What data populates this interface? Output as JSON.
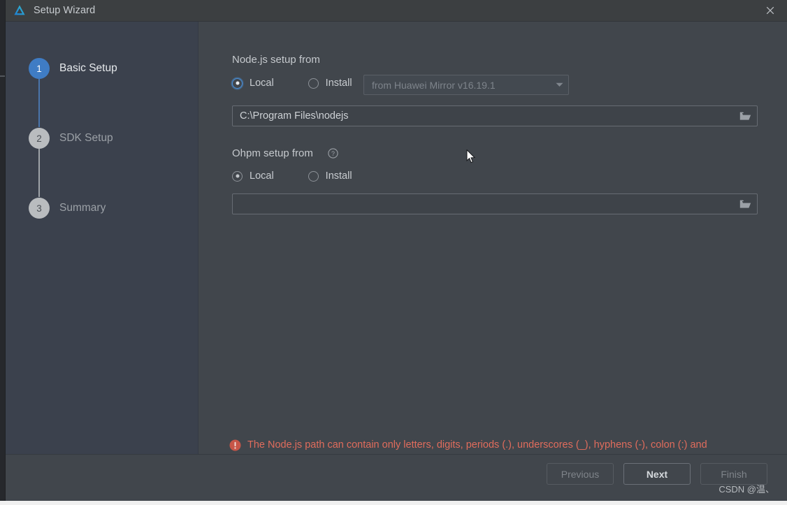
{
  "window": {
    "title": "Setup Wizard",
    "logo_icon": "deveco-logo-icon",
    "close_icon": "close-icon"
  },
  "stepper": {
    "steps": [
      {
        "number": "1",
        "label": "Basic Setup",
        "state": "active"
      },
      {
        "number": "2",
        "label": "SDK Setup",
        "state": "inactive"
      },
      {
        "number": "3",
        "label": "Summary",
        "state": "inactive"
      }
    ]
  },
  "nodejs": {
    "section_title": "Node.js setup from",
    "radios": [
      {
        "label": "Local",
        "selected": true
      },
      {
        "label": "Install",
        "selected": false
      }
    ],
    "mirror_combobox": {
      "value": "from Huawei Mirror v16.19.1",
      "enabled": false,
      "arrow_icon": "chevron-down-icon"
    },
    "path": {
      "value": "C:\\Program Files\\nodejs",
      "placeholder": "",
      "browse_icon": "folder-open-icon"
    }
  },
  "ohpm": {
    "section_title": "Ohpm setup from",
    "help_icon": "help-circle-icon",
    "radios": [
      {
        "label": "Local",
        "selected": true
      },
      {
        "label": "Install",
        "selected": false
      }
    ],
    "path": {
      "value": "",
      "placeholder": "",
      "browse_icon": "folder-open-icon"
    }
  },
  "validation": {
    "icon": "error-circle-icon",
    "message": "The Node.js path can contain only letters, digits, periods (.), underscores (_), hyphens (-), colon (:) and backslash (\\)"
  },
  "footer": {
    "previous_label": "Previous",
    "next_label": "Next",
    "finish_label": "Finish"
  },
  "watermark": {
    "text": "CSDN @温、"
  },
  "colors": {
    "accent_blue": "#3f7cc4",
    "error_red": "#e06c5c",
    "sidebar_bg": "#3b414d",
    "content_bg": "#41464c",
    "titlebar_bg": "#3c3f41"
  }
}
